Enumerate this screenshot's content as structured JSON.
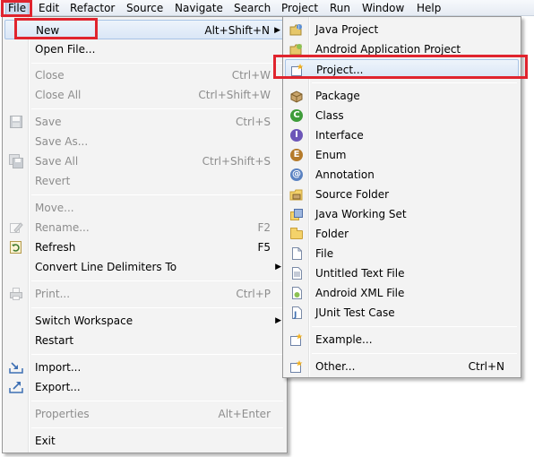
{
  "menubar": {
    "items": [
      "File",
      "Edit",
      "Refactor",
      "Source",
      "Navigate",
      "Search",
      "Project",
      "Run",
      "Window",
      "Help"
    ]
  },
  "file_menu": {
    "new": {
      "label": "New",
      "shortcut": "Alt+Shift+N"
    },
    "open_file": {
      "label": "Open File..."
    },
    "close": {
      "label": "Close",
      "shortcut": "Ctrl+W"
    },
    "close_all": {
      "label": "Close All",
      "shortcut": "Ctrl+Shift+W"
    },
    "save": {
      "label": "Save",
      "shortcut": "Ctrl+S"
    },
    "save_as": {
      "label": "Save As..."
    },
    "save_all": {
      "label": "Save All",
      "shortcut": "Ctrl+Shift+S"
    },
    "revert": {
      "label": "Revert"
    },
    "move": {
      "label": "Move..."
    },
    "rename": {
      "label": "Rename...",
      "shortcut": "F2"
    },
    "refresh": {
      "label": "Refresh",
      "shortcut": "F5"
    },
    "convert": {
      "label": "Convert Line Delimiters To"
    },
    "print": {
      "label": "Print...",
      "shortcut": "Ctrl+P"
    },
    "switch_workspace": {
      "label": "Switch Workspace"
    },
    "restart": {
      "label": "Restart"
    },
    "import": {
      "label": "Import..."
    },
    "export": {
      "label": "Export..."
    },
    "properties": {
      "label": "Properties",
      "shortcut": "Alt+Enter"
    },
    "exit": {
      "label": "Exit"
    }
  },
  "new_menu": {
    "java_project": "Java Project",
    "android_project": "Android Application Project",
    "project": "Project...",
    "package": "Package",
    "class": "Class",
    "interface": "Interface",
    "enum": "Enum",
    "annotation": "Annotation",
    "source_folder": "Source Folder",
    "java_working_set": "Java Working Set",
    "folder": "Folder",
    "file": "File",
    "untitled_text_file": "Untitled Text File",
    "android_xml_file": "Android XML File",
    "junit_test_case": "JUnit Test Case",
    "example": "Example...",
    "other": {
      "label": "Other...",
      "shortcut": "Ctrl+N"
    }
  },
  "colors": {
    "highlight_box": "#e0242e",
    "menu_bg": "#f3f3f3",
    "hover_bg": "#dae6f6"
  }
}
